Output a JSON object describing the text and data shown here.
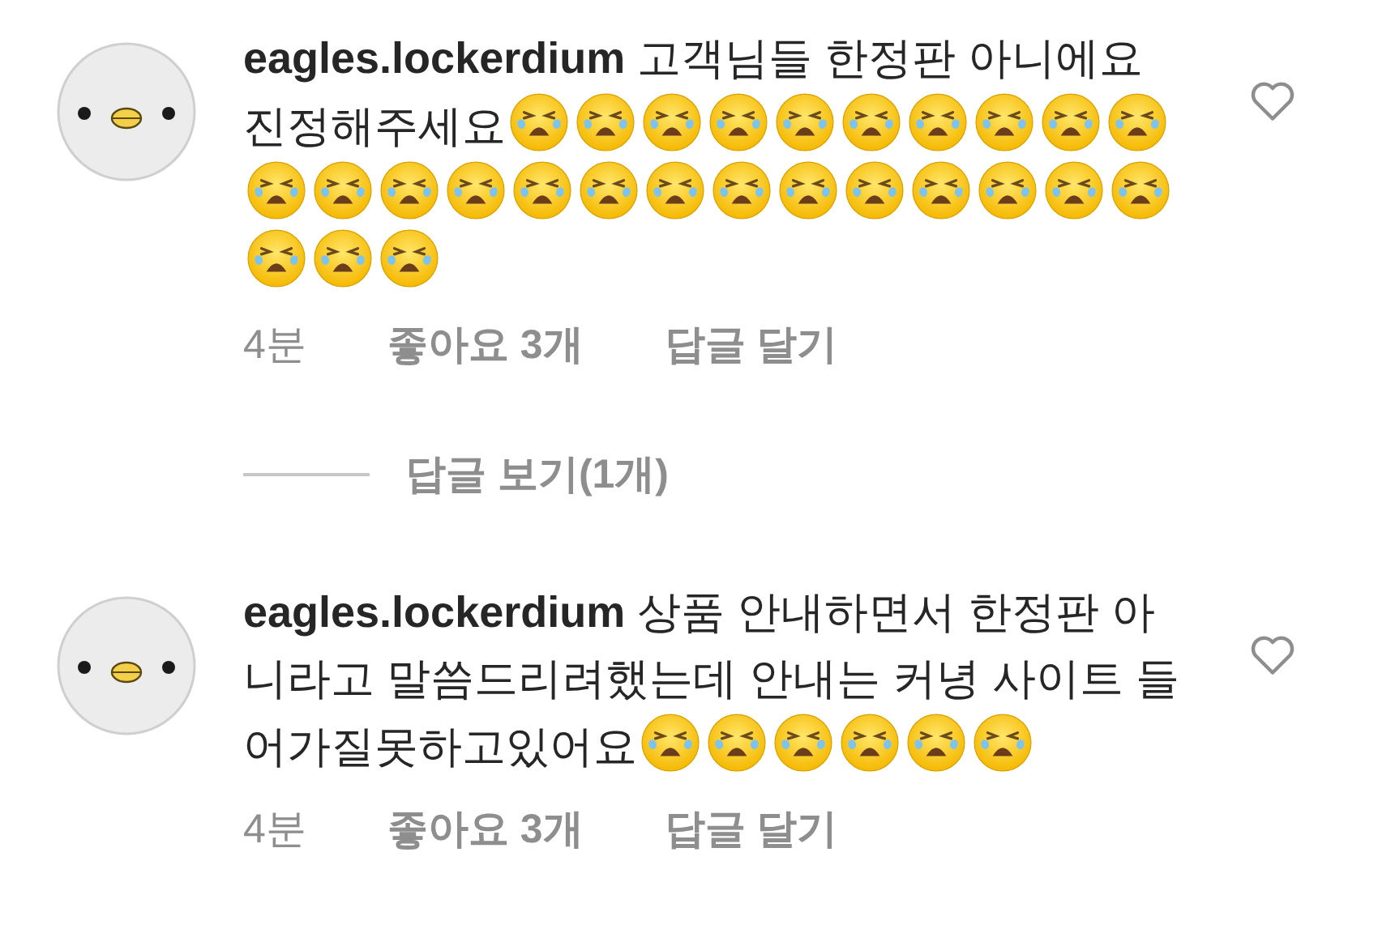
{
  "comments": [
    {
      "username": "eagles.lockerdium",
      "text": "고객님들 한정판 아니에요 진정해주세요",
      "emojis": [
        {
          "kind": "loudly-crying"
        },
        {
          "kind": "loudly-crying"
        },
        {
          "kind": "loudly-crying"
        },
        {
          "kind": "loudly-crying"
        },
        {
          "kind": "loudly-crying"
        },
        {
          "kind": "loudly-crying"
        },
        {
          "kind": "loudly-crying"
        },
        {
          "kind": "loudly-crying"
        },
        {
          "kind": "loudly-crying"
        },
        {
          "kind": "loudly-crying"
        },
        {
          "kind": "loudly-crying"
        },
        {
          "kind": "loudly-crying"
        },
        {
          "kind": "loudly-crying"
        },
        {
          "kind": "loudly-crying"
        },
        {
          "kind": "loudly-crying"
        },
        {
          "kind": "loudly-crying"
        },
        {
          "kind": "loudly-crying"
        },
        {
          "kind": "loudly-crying"
        },
        {
          "kind": "loudly-crying"
        },
        {
          "kind": "loudly-crying"
        },
        {
          "kind": "loudly-crying"
        },
        {
          "kind": "loudly-crying"
        },
        {
          "kind": "loudly-crying"
        },
        {
          "kind": "loudly-crying"
        },
        {
          "kind": "loudly-crying"
        },
        {
          "kind": "loudly-crying"
        },
        {
          "kind": "loudly-crying"
        }
      ],
      "time": "4분",
      "likes": "좋아요 3개",
      "reply": "답글 달기",
      "liked": false,
      "view_replies": "답글 보기(1개)"
    },
    {
      "username": "eagles.lockerdium",
      "text": "상품 안내하면서 한정판 아니라고 말씀드리려했는데 안내는 커녕 사이트 들어가질못하고있어요",
      "emojis": [
        {
          "kind": "loudly-crying"
        },
        {
          "kind": "loudly-crying"
        },
        {
          "kind": "loudly-crying"
        },
        {
          "kind": "loudly-crying"
        },
        {
          "kind": "loudly-crying"
        },
        {
          "kind": "loudly-crying"
        }
      ],
      "time": "4분",
      "likes": "좋아요 3개",
      "reply": "답글 달기",
      "liked": false
    }
  ]
}
